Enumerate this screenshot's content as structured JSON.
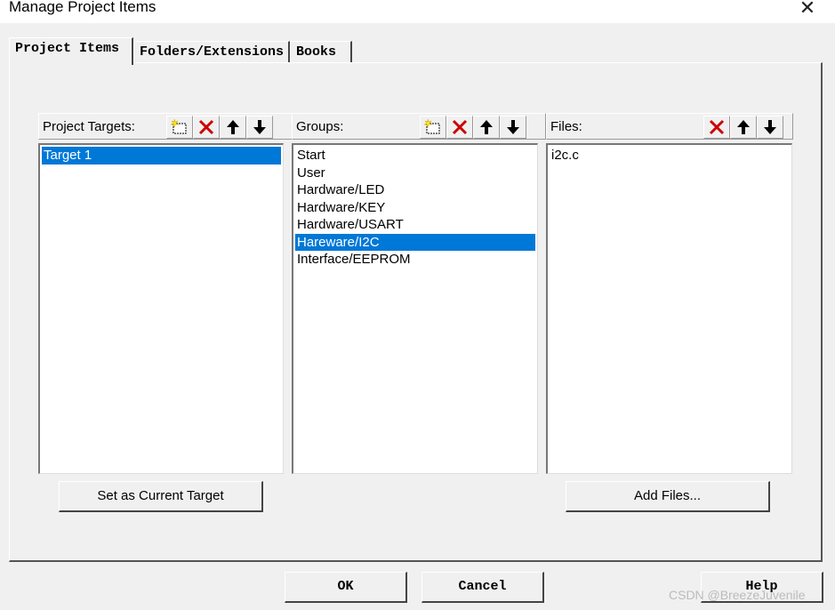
{
  "window": {
    "title": "Manage Project Items",
    "close_glyph": "✕"
  },
  "tabs": [
    {
      "label": "Project Items",
      "active": true
    },
    {
      "label": "Folders/Extensions",
      "active": false
    },
    {
      "label": "Books",
      "active": false
    }
  ],
  "targets": {
    "label": "Project Targets:",
    "items": [
      {
        "text": "Target 1",
        "selected": true
      }
    ]
  },
  "groups": {
    "label": "Groups:",
    "items": [
      {
        "text": "Start",
        "selected": false
      },
      {
        "text": "User",
        "selected": false
      },
      {
        "text": "Hardware/LED",
        "selected": false
      },
      {
        "text": "Hardware/KEY",
        "selected": false
      },
      {
        "text": "Hardware/USART",
        "selected": false
      },
      {
        "text": "Hareware/I2C",
        "selected": true
      },
      {
        "text": "Interface/EEPROM",
        "selected": false
      }
    ]
  },
  "files": {
    "label": "Files:",
    "items": [
      {
        "text": "i2c.c",
        "selected": false
      }
    ]
  },
  "buttons": {
    "set_current_target": "Set as Current Target",
    "add_files": "Add Files...",
    "ok": "OK",
    "cancel": "Cancel",
    "help": "Help"
  },
  "icons": {
    "new": "new-item-icon",
    "delete": "delete-icon",
    "up": "move-up-icon",
    "down": "move-down-icon"
  },
  "colors": {
    "selection": "#0078d7",
    "delete_red": "#cc0000"
  },
  "watermark": "CSDN @BreezeJuvenile"
}
